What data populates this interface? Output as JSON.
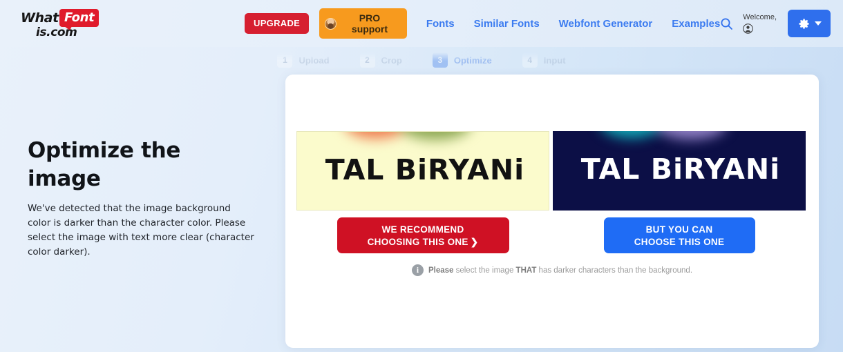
{
  "header": {
    "logo": {
      "part1": "What",
      "part2": "Font",
      "part3": "is.com",
      "badge_color": "#e01b2c"
    },
    "upgrade_label": "UPGRADE",
    "pro_label": "PRO support",
    "nav_links": [
      {
        "label": "Fonts"
      },
      {
        "label": "Similar Fonts"
      },
      {
        "label": "Webfont Generator"
      },
      {
        "label": "Examples"
      }
    ],
    "welcome_text": "Welcome,",
    "link_color": "#3b7bf0",
    "upgrade_color": "#d61f30",
    "pro_color": "#f79a1e",
    "gear_button_color": "#2f6fed"
  },
  "stepper": {
    "steps": [
      {
        "num": "1",
        "label": "Upload",
        "active": false
      },
      {
        "num": "2",
        "label": "Crop",
        "active": false
      },
      {
        "num": "3",
        "label": "Optimize",
        "active": true
      },
      {
        "num": "4",
        "label": "Input",
        "active": false
      }
    ],
    "active_color": "#1c64e8"
  },
  "left_panel": {
    "title": "Optimize the image",
    "body": "We've detected that the image background color is darker than the character color. Please select the image with text more clear (character color darker)."
  },
  "card": {
    "previews": [
      {
        "name": "light-version",
        "text": "TAL BiRYANi",
        "background_color": "#fbfbcc",
        "text_color": "#121212"
      },
      {
        "name": "dark-version",
        "text": "TAL BiRYANi",
        "background_color": "#0c0f46",
        "text_color": "#ffffff"
      }
    ],
    "recommend_button": {
      "line1": "WE RECOMMEND",
      "line2": "CHOOSING THIS ONE",
      "chevron": "❯",
      "color": "#cf1124"
    },
    "alternate_button": {
      "line1": "BUT YOU CAN",
      "line2": "CHOOSE THIS ONE",
      "color": "#1f6cf5"
    },
    "hint": {
      "icon": "i",
      "prefix_bold": "Please",
      "mid": " select the image ",
      "emphasis_bold": "THAT",
      "suffix": " has darker characters than the background."
    }
  }
}
